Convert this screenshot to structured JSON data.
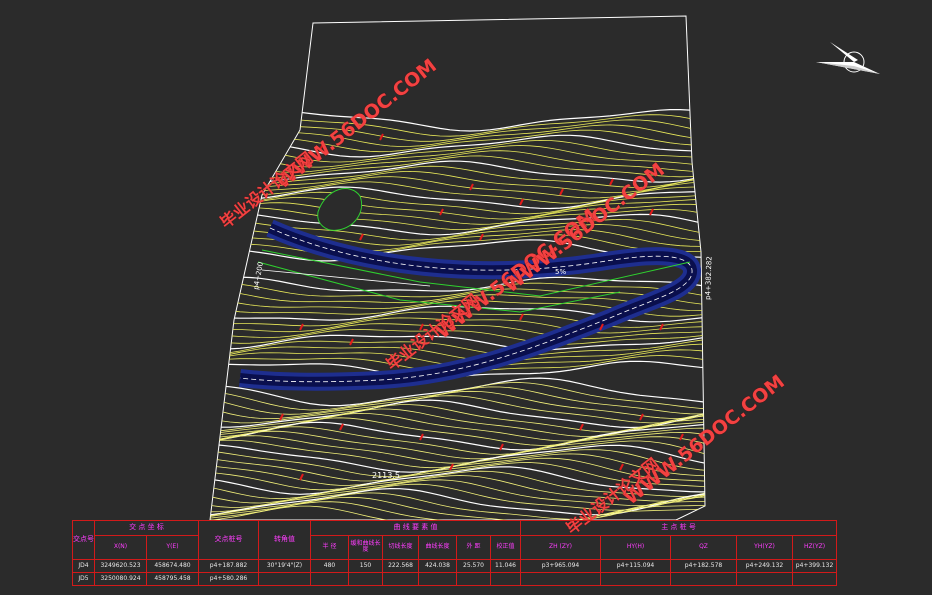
{
  "map": {
    "labels": {
      "chainage_left": "p4+200",
      "chainage_right": "p4+382.282",
      "road_label": "5%",
      "elevation_label": "2113.5"
    }
  },
  "watermark": {
    "url": "WWW.56DOC.COM",
    "cn": "毕业设计论文网"
  },
  "table": {
    "headers": {
      "seq": "交点号",
      "coord": "交 点 坐 标",
      "x": "X(N)",
      "y": "Y(E)",
      "station": "交点桩号",
      "angle": "转角值",
      "curve_elements": "曲 线 要 素 值",
      "radius": "半 径",
      "spiral_len": "缓和曲线长度",
      "tangent": "切线长度",
      "curve_len": "曲线长度",
      "external": "外 距",
      "correction": "校正值",
      "main_points": "主 点 桩 号",
      "zh": "ZH (ZY)",
      "hy": "HY(H)",
      "qz": "QZ",
      "yh": "YH(YZ)",
      "hz": "HZ(YZ)"
    },
    "rows": [
      {
        "seq": "JD4",
        "x": "3249620.523",
        "y": "458674.480",
        "station": "p4+187.882",
        "angle": "30°19'4\"(Z)",
        "radius": "480",
        "spiral_len": "150",
        "tangent": "222.568",
        "curve_len": "424.038",
        "external": "25.570",
        "correction": "11.046",
        "zh": "p3+965.094",
        "hy": "p4+115.094",
        "qz": "p4+182.578",
        "yh": "p4+249.132",
        "hz": "p4+399.132"
      },
      {
        "seq": "JD5",
        "x": "3250080.924",
        "y": "458795.458",
        "station": "p4+580.286",
        "angle": "",
        "radius": "",
        "spiral_len": "",
        "tangent": "",
        "curve_len": "",
        "external": "",
        "correction": "",
        "zh": "",
        "hy": "",
        "qz": "",
        "yh": "",
        "hz": ""
      }
    ]
  }
}
